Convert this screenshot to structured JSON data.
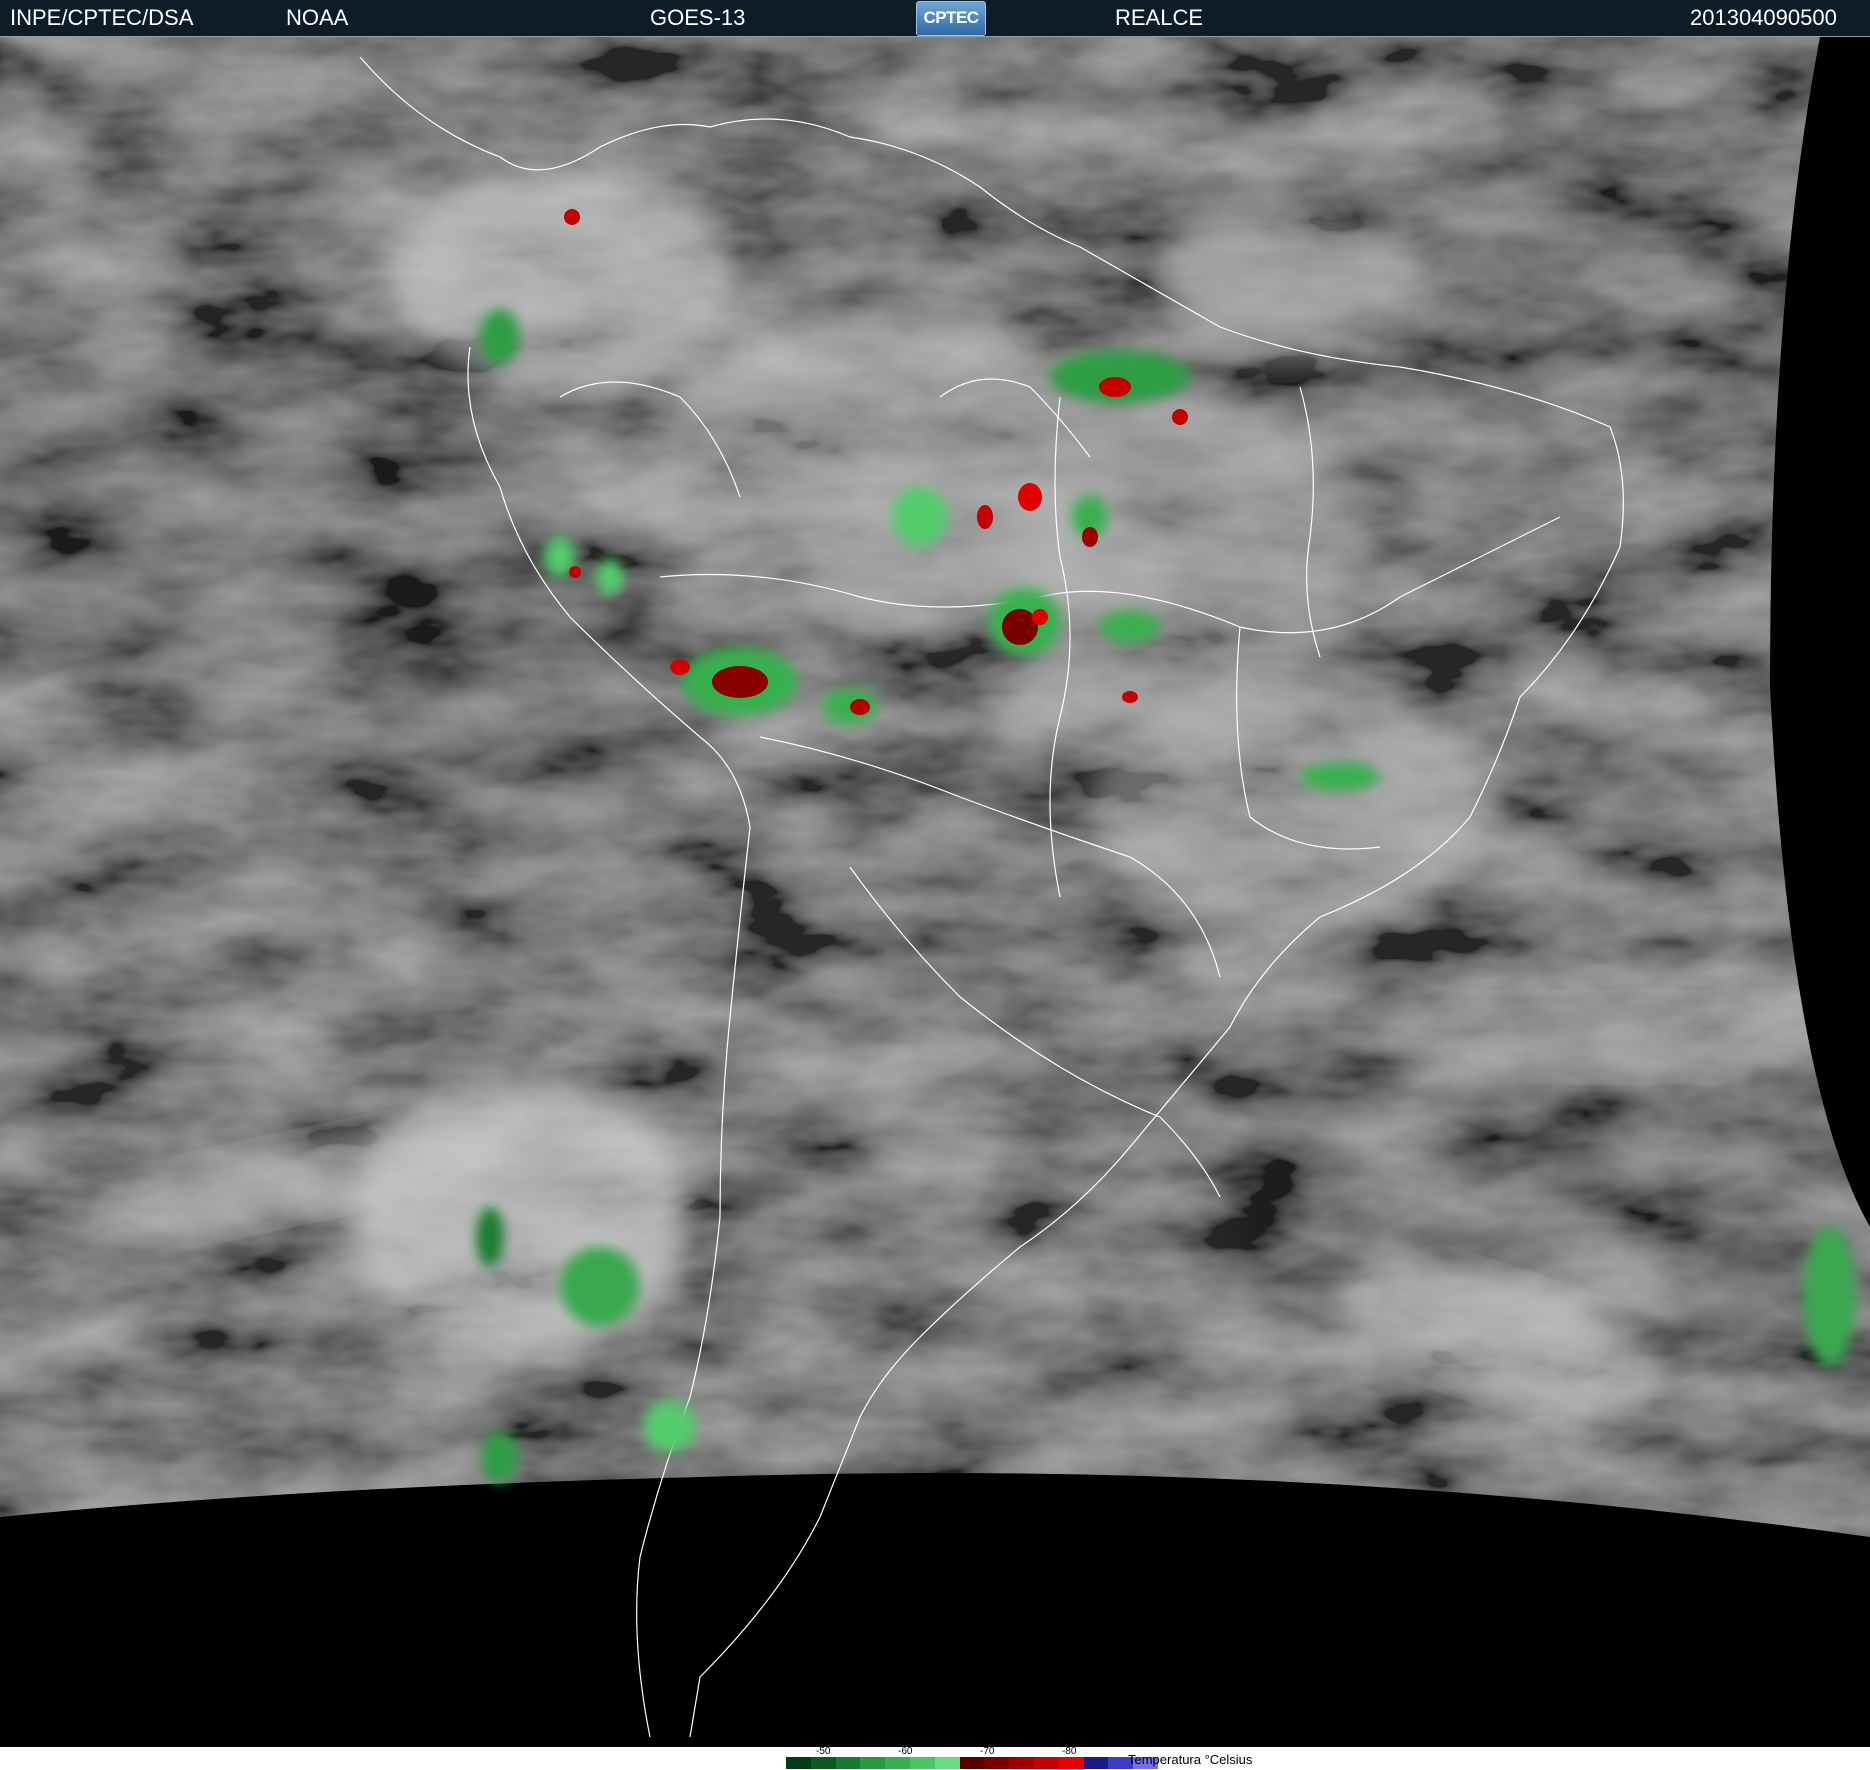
{
  "header": {
    "source": "INPE/CPTEC/DSA",
    "agency": "NOAA",
    "satellite": "GOES-13",
    "logo_text": "CPTEC",
    "product": "REALCE",
    "datetime": "201304090500"
  },
  "colors": {
    "header_bg": "#0e1c28",
    "background": "#000000",
    "cloud_gray": "#5a5a5a",
    "coastline": "#ffffff"
  },
  "scale": {
    "ticks": [
      "-50",
      "-60",
      "-70",
      "-80"
    ],
    "label": "Temperatura °Celsius",
    "colors": [
      "#003d14",
      "#0b5a22",
      "#177a2f",
      "#259b3f",
      "#35b04f",
      "#4cc565",
      "#66dd80",
      "#5a0000",
      "#7a0000",
      "#9e0000",
      "#c40000",
      "#e80000",
      "#1a1a8a",
      "#3b3bc4",
      "#7070ee"
    ]
  }
}
